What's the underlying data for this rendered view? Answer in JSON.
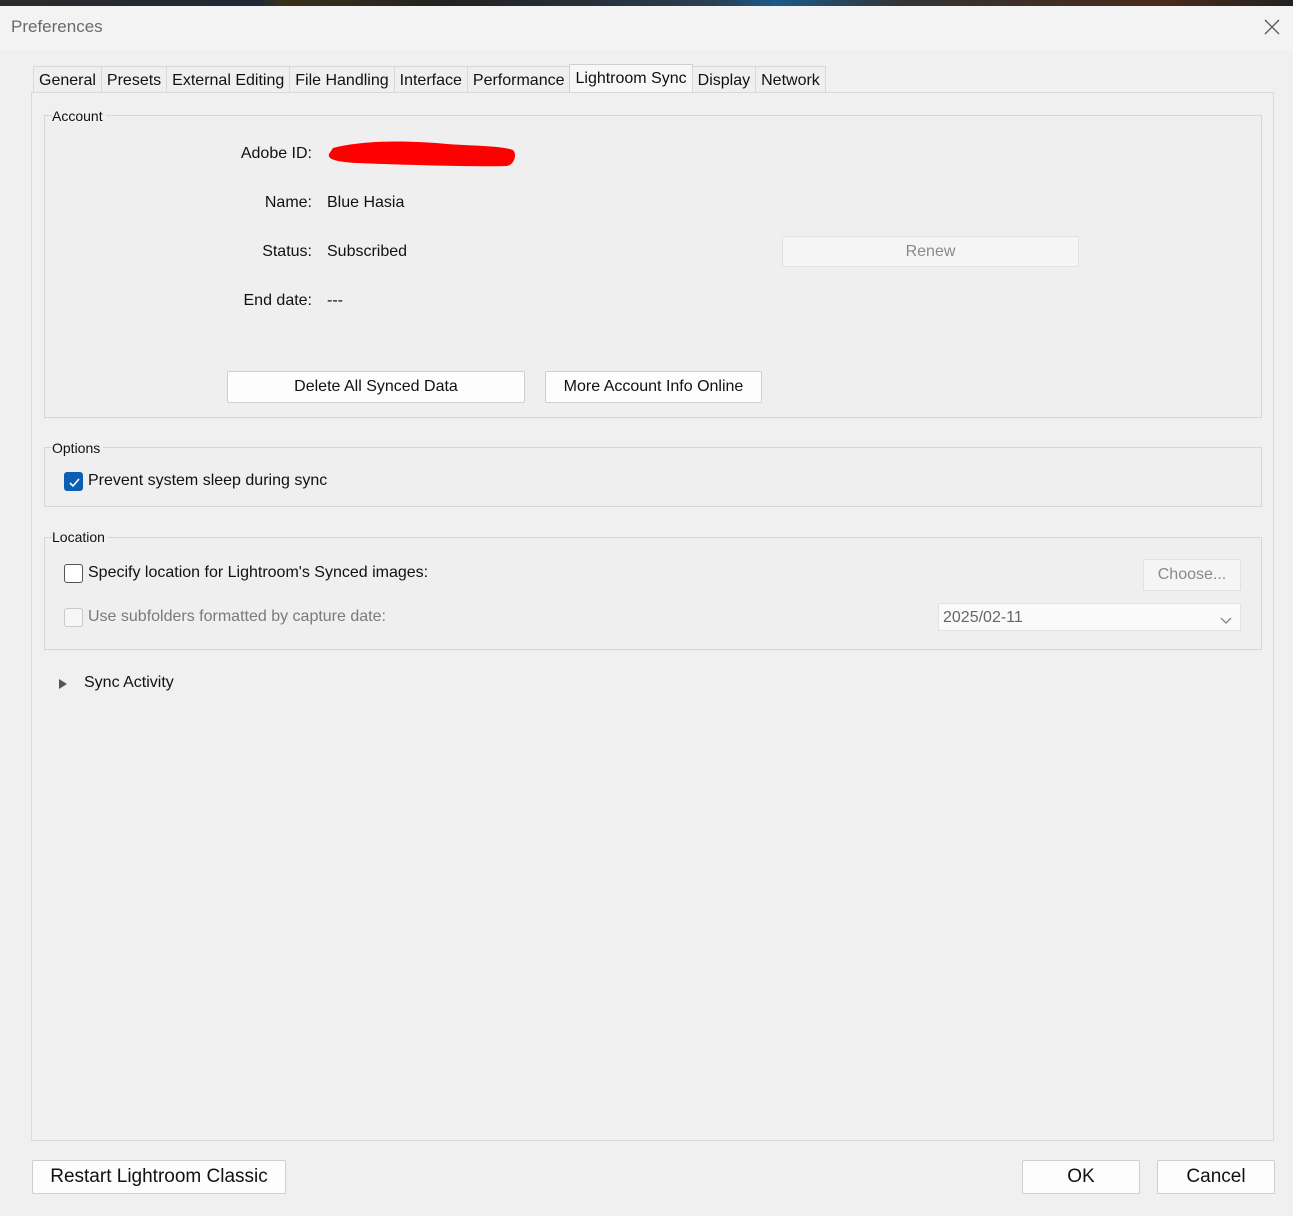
{
  "window": {
    "title": "Preferences",
    "close_icon": "close-icon"
  },
  "tabs": [
    {
      "label": "General",
      "active": false
    },
    {
      "label": "Presets",
      "active": false
    },
    {
      "label": "External Editing",
      "active": false
    },
    {
      "label": "File Handling",
      "active": false
    },
    {
      "label": "Interface",
      "active": false
    },
    {
      "label": "Performance",
      "active": false
    },
    {
      "label": "Lightroom Sync",
      "active": true
    },
    {
      "label": "Display",
      "active": false
    },
    {
      "label": "Network",
      "active": false
    }
  ],
  "account": {
    "group_label": "Account",
    "adobe_id_label": "Adobe ID:",
    "adobe_id_redacted_color": "#ff0000",
    "name_label": "Name:",
    "name_value": "Blue Hasia",
    "status_label": "Status:",
    "status_value": "Subscribed",
    "renew_button": "Renew",
    "end_date_label": "End date:",
    "end_date_value": "---",
    "delete_button": "Delete All Synced Data",
    "more_info_button": "More Account Info Online"
  },
  "options": {
    "group_label": "Options",
    "prevent_sleep_label": "Prevent system sleep during sync",
    "prevent_sleep_checked": true
  },
  "location": {
    "group_label": "Location",
    "specify_label": "Specify location for Lightroom's Synced images:",
    "specify_checked": false,
    "choose_button": "Choose...",
    "subfolders_label": "Use subfolders formatted by capture date:",
    "subfolders_checked": false,
    "date_format_value": "2025/02-11"
  },
  "sync_activity": {
    "label": "Sync Activity"
  },
  "footer": {
    "restart_button": "Restart Lightroom Classic",
    "ok_button": "OK",
    "cancel_button": "Cancel"
  },
  "colors": {
    "accent": "#0a5fb4",
    "background": "#f0f0f0"
  }
}
